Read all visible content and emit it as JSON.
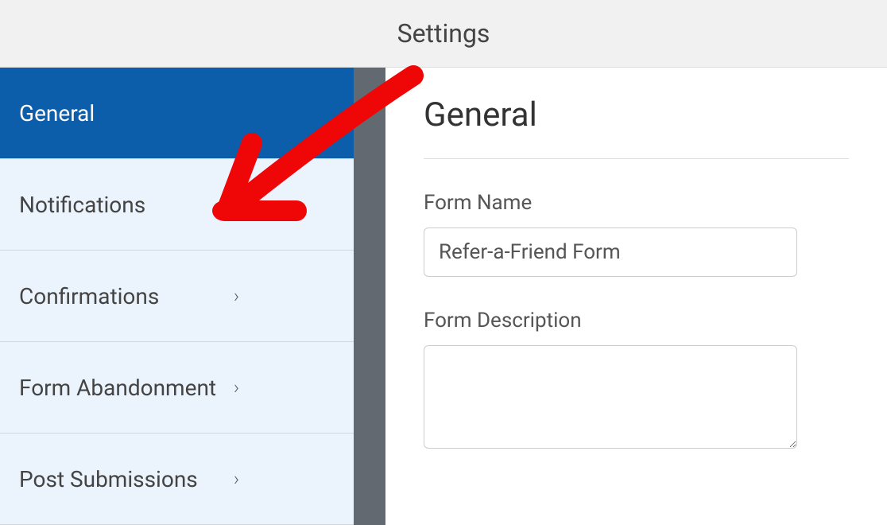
{
  "header": {
    "title": "Settings"
  },
  "sidebar": {
    "items": [
      {
        "label": "General",
        "active": true,
        "hasChevron": false
      },
      {
        "label": "Notifications",
        "active": false,
        "hasChevron": false
      },
      {
        "label": "Confirmations",
        "active": false,
        "hasChevron": true
      },
      {
        "label": "Form Abandonment",
        "active": false,
        "hasChevron": true
      },
      {
        "label": "Post Submissions",
        "active": false,
        "hasChevron": true
      }
    ]
  },
  "main": {
    "title": "General",
    "formNameLabel": "Form Name",
    "formNameValue": "Refer-a-Friend Form",
    "formDescriptionLabel": "Form Description",
    "formDescriptionValue": ""
  },
  "annotation": {
    "color": "#ef0707"
  }
}
